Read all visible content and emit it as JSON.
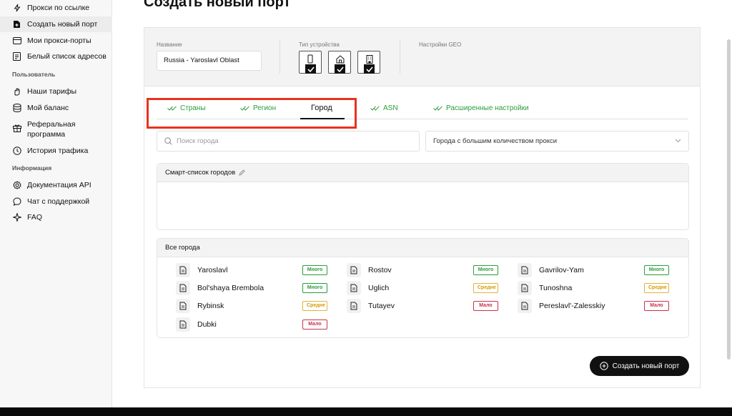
{
  "sidebar": {
    "items_top": [
      {
        "label": "Прокси по ссылке",
        "icon": "lightning-icon"
      },
      {
        "label": "Создать новый порт",
        "icon": "file-plus-icon",
        "active": true
      },
      {
        "label": "Мои прокси-порты",
        "icon": "card-icon"
      },
      {
        "label": "Белый список адресов",
        "icon": "list-icon"
      }
    ],
    "section_user": "Пользователь",
    "items_user": [
      {
        "label": "Наши тарифы",
        "icon": "hand-icon"
      },
      {
        "label": "Мой баланс",
        "icon": "database-icon"
      },
      {
        "label": "Реферальная",
        "label2": "программа",
        "icon": "gift-icon"
      },
      {
        "label": "История трафика",
        "icon": "clock-icon"
      }
    ],
    "section_info": "Информация",
    "items_info": [
      {
        "label": "Документация API",
        "icon": "gear-icon"
      },
      {
        "label": "Чат с поддержкой",
        "icon": "chat-icon"
      },
      {
        "label": "FAQ",
        "icon": "sparkle-icon"
      }
    ]
  },
  "page": {
    "title": "Создать новый порт"
  },
  "form": {
    "name_label": "Название",
    "name_value": "Russia - Yaroslavl Oblast",
    "device_label": "Тип устройства",
    "geo_label": "Настройки GEO"
  },
  "tabs": [
    {
      "label": "Страны",
      "state": "done"
    },
    {
      "label": "Регион",
      "state": "done"
    },
    {
      "label": "Город",
      "state": "active"
    },
    {
      "label": "ASN",
      "state": "done"
    },
    {
      "label": "Расширенные настройки",
      "state": "done"
    }
  ],
  "search": {
    "placeholder": "Поиск города"
  },
  "filter": {
    "selected": "Города с большим количеством прокси"
  },
  "smart_list": {
    "title": "Смарт-список городов"
  },
  "all_cities": {
    "title": "Все города",
    "cities": [
      {
        "name": "Yaroslavl",
        "badge": "Много",
        "level": "many"
      },
      {
        "name": "Rostov",
        "badge": "Много",
        "level": "many"
      },
      {
        "name": "Gavrilov-Yam",
        "badge": "Много",
        "level": "many"
      },
      {
        "name": "Bol'shaya Brembola",
        "badge": "Много",
        "level": "many"
      },
      {
        "name": "Uglich",
        "badge": "Средне",
        "level": "mid"
      },
      {
        "name": "Tunoshna",
        "badge": "Средне",
        "level": "mid"
      },
      {
        "name": "Rybinsk",
        "badge": "Средне",
        "level": "mid"
      },
      {
        "name": "Tutayev",
        "badge": "Мало",
        "level": "few"
      },
      {
        "name": "Pereslavl'-Zalesskiy",
        "badge": "Мало",
        "level": "few"
      },
      {
        "name": "Dubki",
        "badge": "Мало",
        "level": "few"
      }
    ]
  },
  "create_button": {
    "label": "Создать новый порт"
  },
  "colors": {
    "accent_green": "#2a9d3a",
    "highlight_red": "#e8321e",
    "badge_mid": "#d69a00",
    "badge_few": "#c8334b"
  }
}
